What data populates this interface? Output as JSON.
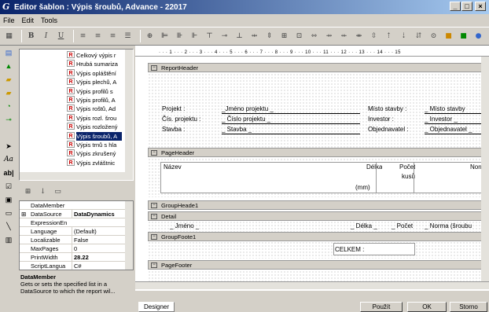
{
  "window": {
    "title": "Editor šablon : Výpis šroubů, Advance - 22017",
    "min": "_",
    "max": "□",
    "close": "×"
  },
  "menu": [
    "File",
    "Edit",
    "Tools"
  ],
  "tree": {
    "items": [
      "Celkový výpis r",
      "Hrubá sumariza",
      "Výpis opláštění",
      "Výpis plechů, A",
      "Výpis profilů s",
      "Výpis profilů, A",
      "Výpis roštů, Ad",
      "Výpis rozl. šrou",
      "Výpis rozložený",
      "Výpis šroubů, A",
      "Výpis trnů s hla",
      "Výpis zkrušený",
      "Výpis zvláštnic"
    ],
    "selected": 9
  },
  "props": {
    "rows": [
      {
        "k": "DataMember",
        "v": ""
      },
      {
        "k": "DataSource",
        "v": "DataDynamics",
        "bold": true,
        "expand": "⊞"
      },
      {
        "k": "ExpressionEn",
        "v": ""
      },
      {
        "k": "Language",
        "v": "(Default)"
      },
      {
        "k": "Localizable",
        "v": "False"
      },
      {
        "k": "MaxPages",
        "v": "0"
      },
      {
        "k": "PrintWidth",
        "v": "28.22",
        "bold": true
      },
      {
        "k": "ScriptLangua",
        "v": "C#"
      }
    ],
    "desc_title": "DataMember",
    "desc_text": "Gets or sets the specified list in a DataSource to which the report wil..."
  },
  "ruler": "· · · 1 · · · 2 · · · 3 · · · 4 · · · 5 · · · 6 · · · 7 · · · 8 · · · 9 · · · 10 · · · 11 · · · 12 · · · 13 · · · 14 · · · 15",
  "bands": {
    "report_header": "ReportHeader",
    "page_header": "PageHeader",
    "group_header": "GroupHeade1",
    "detail": "Detail",
    "group_footer": "GroupFoote1",
    "page_footer": "PageFooter"
  },
  "report_header": {
    "projekt": "Projekt :",
    "jmeno_projektu": "_Jméno projektu _",
    "misto_stavby_lbl": "Místo stavby :",
    "misto_stavby": "_ Místo stavby",
    "cis_projektu": "Čís. projektu :",
    "cislo_projektu": "_ Číslo projektu _",
    "investor_lbl": "Investor :",
    "investor": "_ Investor _",
    "stavba_lbl": "Stavba :",
    "stavba": "_ Stavba _",
    "objednavatel_lbl": "Objednavatel :",
    "objednavatel": "_ Objednavatel _"
  },
  "page_header": {
    "nazev": "Název",
    "delka": "Délka",
    "pocet": "Počet",
    "kusu": "kusů",
    "norm": "Norr",
    "mm": "(mm)"
  },
  "detail": {
    "jmeno": "_ Jméno _",
    "delka": "_ Délka _",
    "pocet": "_ Počet",
    "norma": "_ Norma (šroubu"
  },
  "group_footer": {
    "celkem": "CELKEM :"
  },
  "status": {
    "designer_tab": "Designer",
    "pouzit": "Použít",
    "ok": "OK",
    "storno": "Storno"
  }
}
